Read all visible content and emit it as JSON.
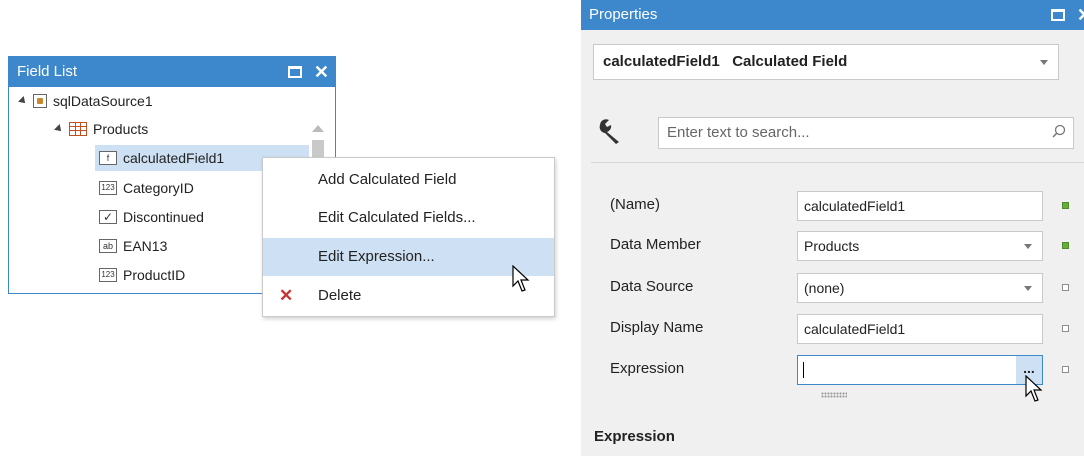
{
  "field_list": {
    "title": "Field List",
    "tree": [
      {
        "label": "sqlDataSource1",
        "icon": "database-icon"
      },
      {
        "label": "Products",
        "icon": "table-icon"
      },
      {
        "label": "calculatedField1",
        "icon": "calculated-field-icon",
        "glyph": "f"
      },
      {
        "label": "CategoryID",
        "icon": "number-field-icon",
        "glyph": "123"
      },
      {
        "label": "Discontinued",
        "icon": "boolean-field-icon",
        "glyph": "✓"
      },
      {
        "label": "EAN13",
        "icon": "string-field-icon",
        "glyph": "ab"
      },
      {
        "label": "ProductID",
        "icon": "number-field-icon",
        "glyph": "123"
      }
    ]
  },
  "context_menu": {
    "items": [
      {
        "label": "Add Calculated Field"
      },
      {
        "label": "Edit Calculated Fields..."
      },
      {
        "label": "Edit Expression..."
      },
      {
        "label": "Delete",
        "icon": "delete-icon"
      }
    ]
  },
  "properties": {
    "title": "Properties",
    "selected_object": "calculatedField1   Calculated Field",
    "search_placeholder": "Enter text to search...",
    "rows": [
      {
        "name": "(Name)",
        "value": "calculatedField1"
      },
      {
        "name": "Data Member",
        "value": "Products"
      },
      {
        "name": "Data Source",
        "value": "(none)"
      },
      {
        "name": "Display Name",
        "value": "calculatedField1"
      },
      {
        "name": "Expression",
        "value": ""
      }
    ],
    "ellipsis": "...",
    "description_title": "Expression"
  },
  "colors": {
    "title_bar": "#3d88cc",
    "selection": "#cde0f4",
    "set_marker": "#6aac3c",
    "delete_red": "#c83232"
  }
}
